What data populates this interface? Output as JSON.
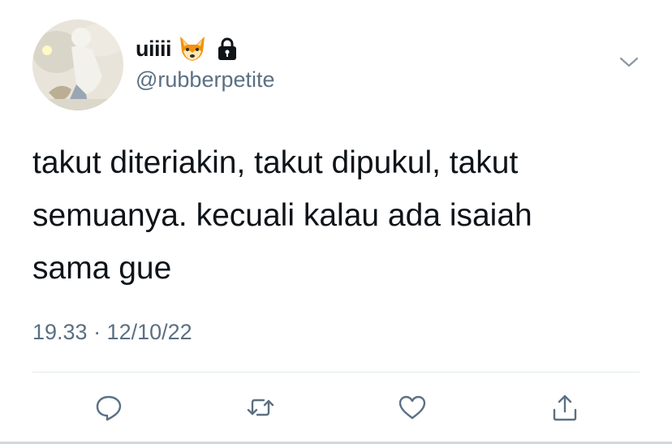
{
  "header": {
    "display_name": "uiiii",
    "name_emoji": "🦊",
    "handle": "@rubberpetite",
    "icons": [
      "fox-emoji-icon",
      "lock-icon",
      "chevron-down-icon"
    ]
  },
  "tweet": {
    "lines": [
      "takut diteriakin, takut dipukul, takut",
      "semuanya. kecuali kalau ada isaiah",
      "sama gue"
    ],
    "timestamp": "19.33 · 12/10/22"
  },
  "actions": [
    "reply-icon",
    "retweet-icon",
    "like-icon",
    "share-icon"
  ],
  "colors": {
    "text": "#0f1419",
    "secondary": "#5b7083",
    "divider": "#e1e8ed"
  }
}
